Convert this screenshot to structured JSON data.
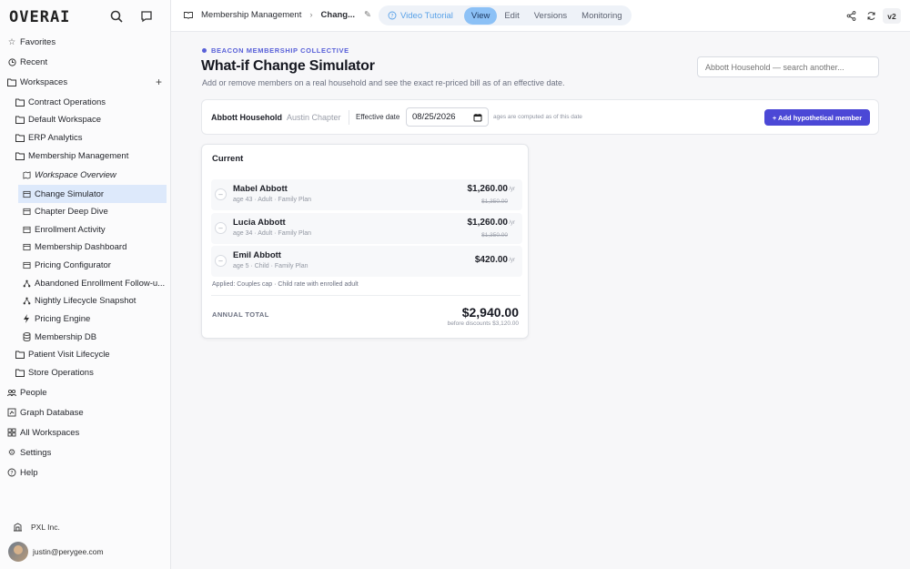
{
  "app": {
    "logo": "OVERAI"
  },
  "sidebar": {
    "favorites": "Favorites",
    "recent": "Recent",
    "workspaces": "Workspaces",
    "workspace_items": [
      "Contract Operations",
      "Default Workspace",
      "ERP Analytics",
      "Membership Management"
    ],
    "membership_children": [
      "Workspace Overview",
      "Change Simulator",
      "Chapter Deep Dive",
      "Enrollment Activity",
      "Membership Dashboard",
      "Pricing Configurator",
      "Abandoned Enrollment Follow-u...",
      "Nightly Lifecycle Snapshot",
      "Pricing Engine",
      "Membership DB"
    ],
    "more_workspaces": [
      "Patient Visit Lifecycle",
      "Store Operations"
    ],
    "people": "People",
    "graph_database": "Graph Database",
    "all_workspaces": "All Workspaces",
    "settings": "Settings",
    "help": "Help",
    "org": "PXL Inc.",
    "user_email": "justin@perygee.com"
  },
  "topbar": {
    "crumb_parent": "Membership Management",
    "crumb_current": "Chang...",
    "video_tutorial": "Video Tutorial",
    "tabs": [
      "View",
      "Edit",
      "Versions",
      "Monitoring"
    ],
    "version": "v2"
  },
  "main": {
    "org_label": "BEACON MEMBERSHIP COLLECTIVE",
    "title": "What-if Change Simulator",
    "subtitle": "Add or remove members on a real household and see the exact re-priced bill as of an effective date.",
    "search_placeholder": "Abbott Household — search another...",
    "toolbar": {
      "household": "Abbott Household",
      "chapter": "Austin Chapter",
      "effective_label": "Effective date",
      "effective_date": "08/25/2026",
      "note": "ages are computed as of this date",
      "add_button": "+ Add hypothetical member"
    },
    "card": {
      "heading": "Current",
      "members": [
        {
          "name": "Mabel Abbott",
          "meta": "age 43 · Adult · Family Plan",
          "price": "$1,260.00",
          "unit": "/yr",
          "old": "$1,350.00"
        },
        {
          "name": "Lucia Abbott",
          "meta": "age 34 · Adult · Family Plan",
          "price": "$1,260.00",
          "unit": "/yr",
          "old": "$1,350.00"
        },
        {
          "name": "Emil Abbott",
          "meta": "age 5 · Child · Family Plan",
          "price": "$420.00",
          "unit": "/yr",
          "old": ""
        }
      ],
      "remove_symbol": "–",
      "applied": "Applied: Couples cap · Child rate with enrolled adult",
      "total_label": "ANNUAL TOTAL",
      "total_value": "$2,940.00",
      "total_sub": "before discounts $3,120.00"
    }
  },
  "colors": {
    "accent": "#4b48d6",
    "active_tab": "#8cc1f6",
    "org_label": "#5860d8"
  }
}
